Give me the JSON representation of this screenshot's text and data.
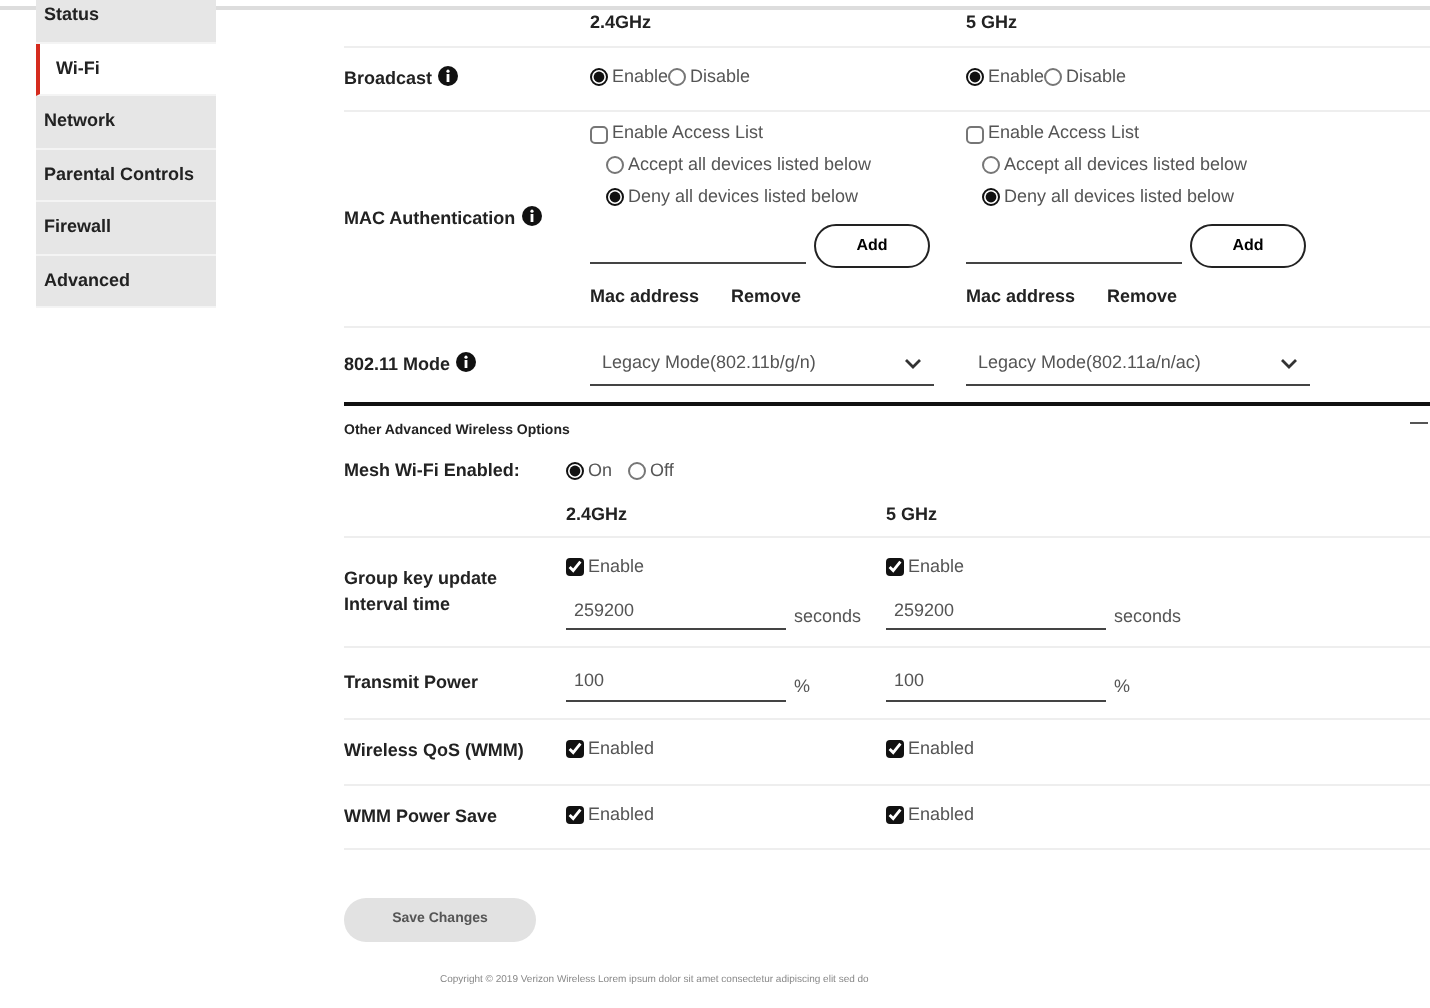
{
  "sidebar": {
    "items": [
      {
        "label": "Status",
        "selected": false
      },
      {
        "label": "Wi-Fi",
        "selected": true
      },
      {
        "label": "Network",
        "selected": false
      },
      {
        "label": "Parental Controls",
        "selected": false
      },
      {
        "label": "Firewall",
        "selected": false
      },
      {
        "label": "Advanced",
        "selected": false
      }
    ]
  },
  "wifi": {
    "bands": [
      "2.4GHz",
      "5 GHz"
    ],
    "broadcast": {
      "label": "Broadcast",
      "bands": [
        {
          "options": [
            {
              "label": "Enable",
              "selected": true
            },
            {
              "label": "Disable",
              "selected": false
            }
          ]
        },
        {
          "options": [
            {
              "label": "Enable",
              "selected": true
            },
            {
              "label": "Disable",
              "selected": false
            }
          ]
        }
      ]
    },
    "mac_authentication": {
      "label": "MAC Authentication",
      "bands": [
        {
          "access_list": {
            "label": "Enable Access List",
            "checked": false
          },
          "policies": [
            {
              "label": "Accept all devices listed below",
              "selected": false
            },
            {
              "label": "Deny all devices listed below",
              "selected": true
            }
          ],
          "add_button": "Add",
          "columns": [
            "Mac address",
            "Remove"
          ]
        },
        {
          "access_list": {
            "label": "Enable Access List",
            "checked": false
          },
          "policies": [
            {
              "label": "Accept all devices listed below",
              "selected": false
            },
            {
              "label": "Deny all devices listed below",
              "selected": true
            }
          ],
          "add_button": "Add",
          "columns": [
            "Mac address",
            "Remove"
          ]
        }
      ]
    },
    "mode": {
      "label": "802.11 Mode",
      "bands": [
        {
          "value": "Legacy Mode(802.11b/g/n)"
        },
        {
          "value": "Legacy Mode(802.11a/n/ac)"
        }
      ]
    }
  },
  "advanced": {
    "title": "Other Advanced Wireless Options",
    "mesh": {
      "label": "Mesh Wi-Fi Enabled:",
      "options": [
        {
          "label": "On",
          "selected": true
        },
        {
          "label": "Off",
          "selected": false
        }
      ]
    },
    "bands": [
      "2.4GHz",
      "5 GHz"
    ],
    "group_key": {
      "label": "Group key update Interval time",
      "bands": [
        {
          "enable": {
            "label": "Enable",
            "checked": true
          },
          "value": "259200",
          "unit": "seconds"
        },
        {
          "enable": {
            "label": "Enable",
            "checked": true
          },
          "value": "259200",
          "unit": "seconds"
        }
      ]
    },
    "transmit_power": {
      "label": "Transmit Power",
      "bands": [
        {
          "value": "100",
          "unit": "%"
        },
        {
          "value": "100",
          "unit": "%"
        }
      ]
    },
    "toggles": [
      {
        "label": "Wireless QoS (WMM)",
        "bands": [
          {
            "label": "Enabled",
            "checked": true
          },
          {
            "label": "Enabled",
            "checked": true
          }
        ]
      },
      {
        "label": "WMM Power Save",
        "bands": [
          {
            "label": "Enabled",
            "checked": true
          },
          {
            "label": "Enabled",
            "checked": true
          }
        ]
      }
    ]
  },
  "save_button": {
    "label": "Save Changes",
    "disabled": true
  },
  "footer": "Copyright © 2019 Verizon Wireless Lorem ipsum dolor sit amet consectetur adipiscing elit sed do"
}
